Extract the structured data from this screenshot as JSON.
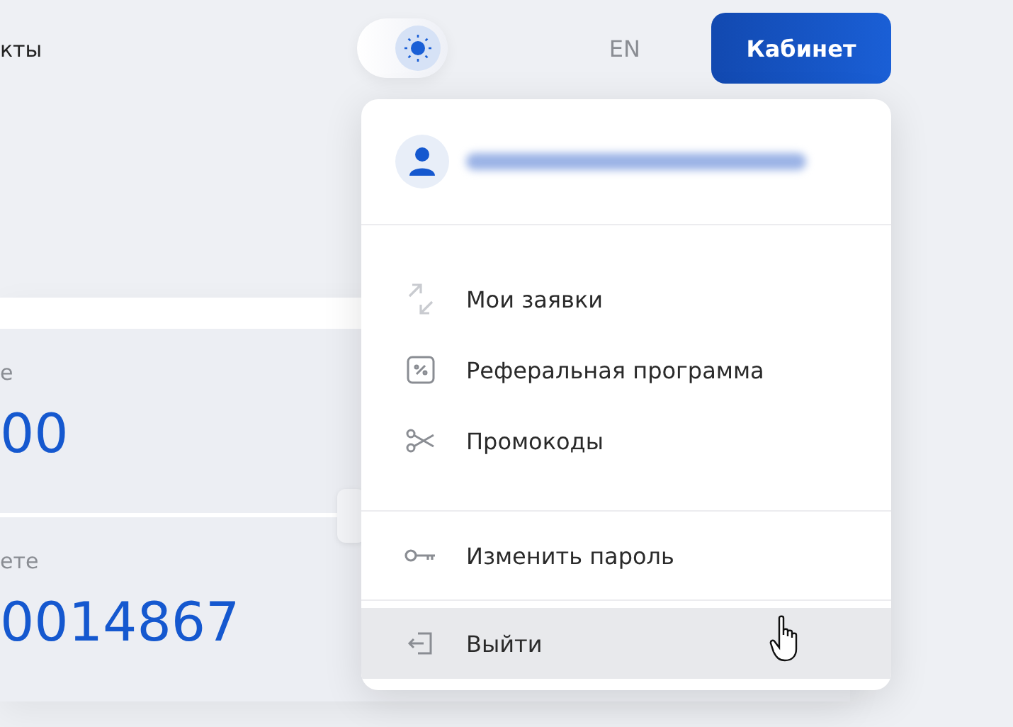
{
  "header": {
    "nav_partial": "кты",
    "theme_toggle": {
      "dark": false
    },
    "language": "EN",
    "cabinet_button": "Кабинет"
  },
  "background_card": {
    "fields": [
      {
        "label": "е",
        "value": "00"
      },
      {
        "label": "ете",
        "value": "0014867"
      }
    ]
  },
  "account_menu": {
    "email_blurred": true,
    "groups": [
      {
        "items": [
          {
            "label": "Мои заявки",
            "hovered": false
          },
          {
            "label": "Реферальная программа",
            "hovered": false
          },
          {
            "label": "Промокоды",
            "hovered": false
          }
        ]
      },
      {
        "items": [
          {
            "label": "Изменить пароль",
            "hovered": false
          }
        ]
      },
      {
        "items": [
          {
            "label": "Выйти",
            "hovered": true
          }
        ]
      }
    ]
  }
}
